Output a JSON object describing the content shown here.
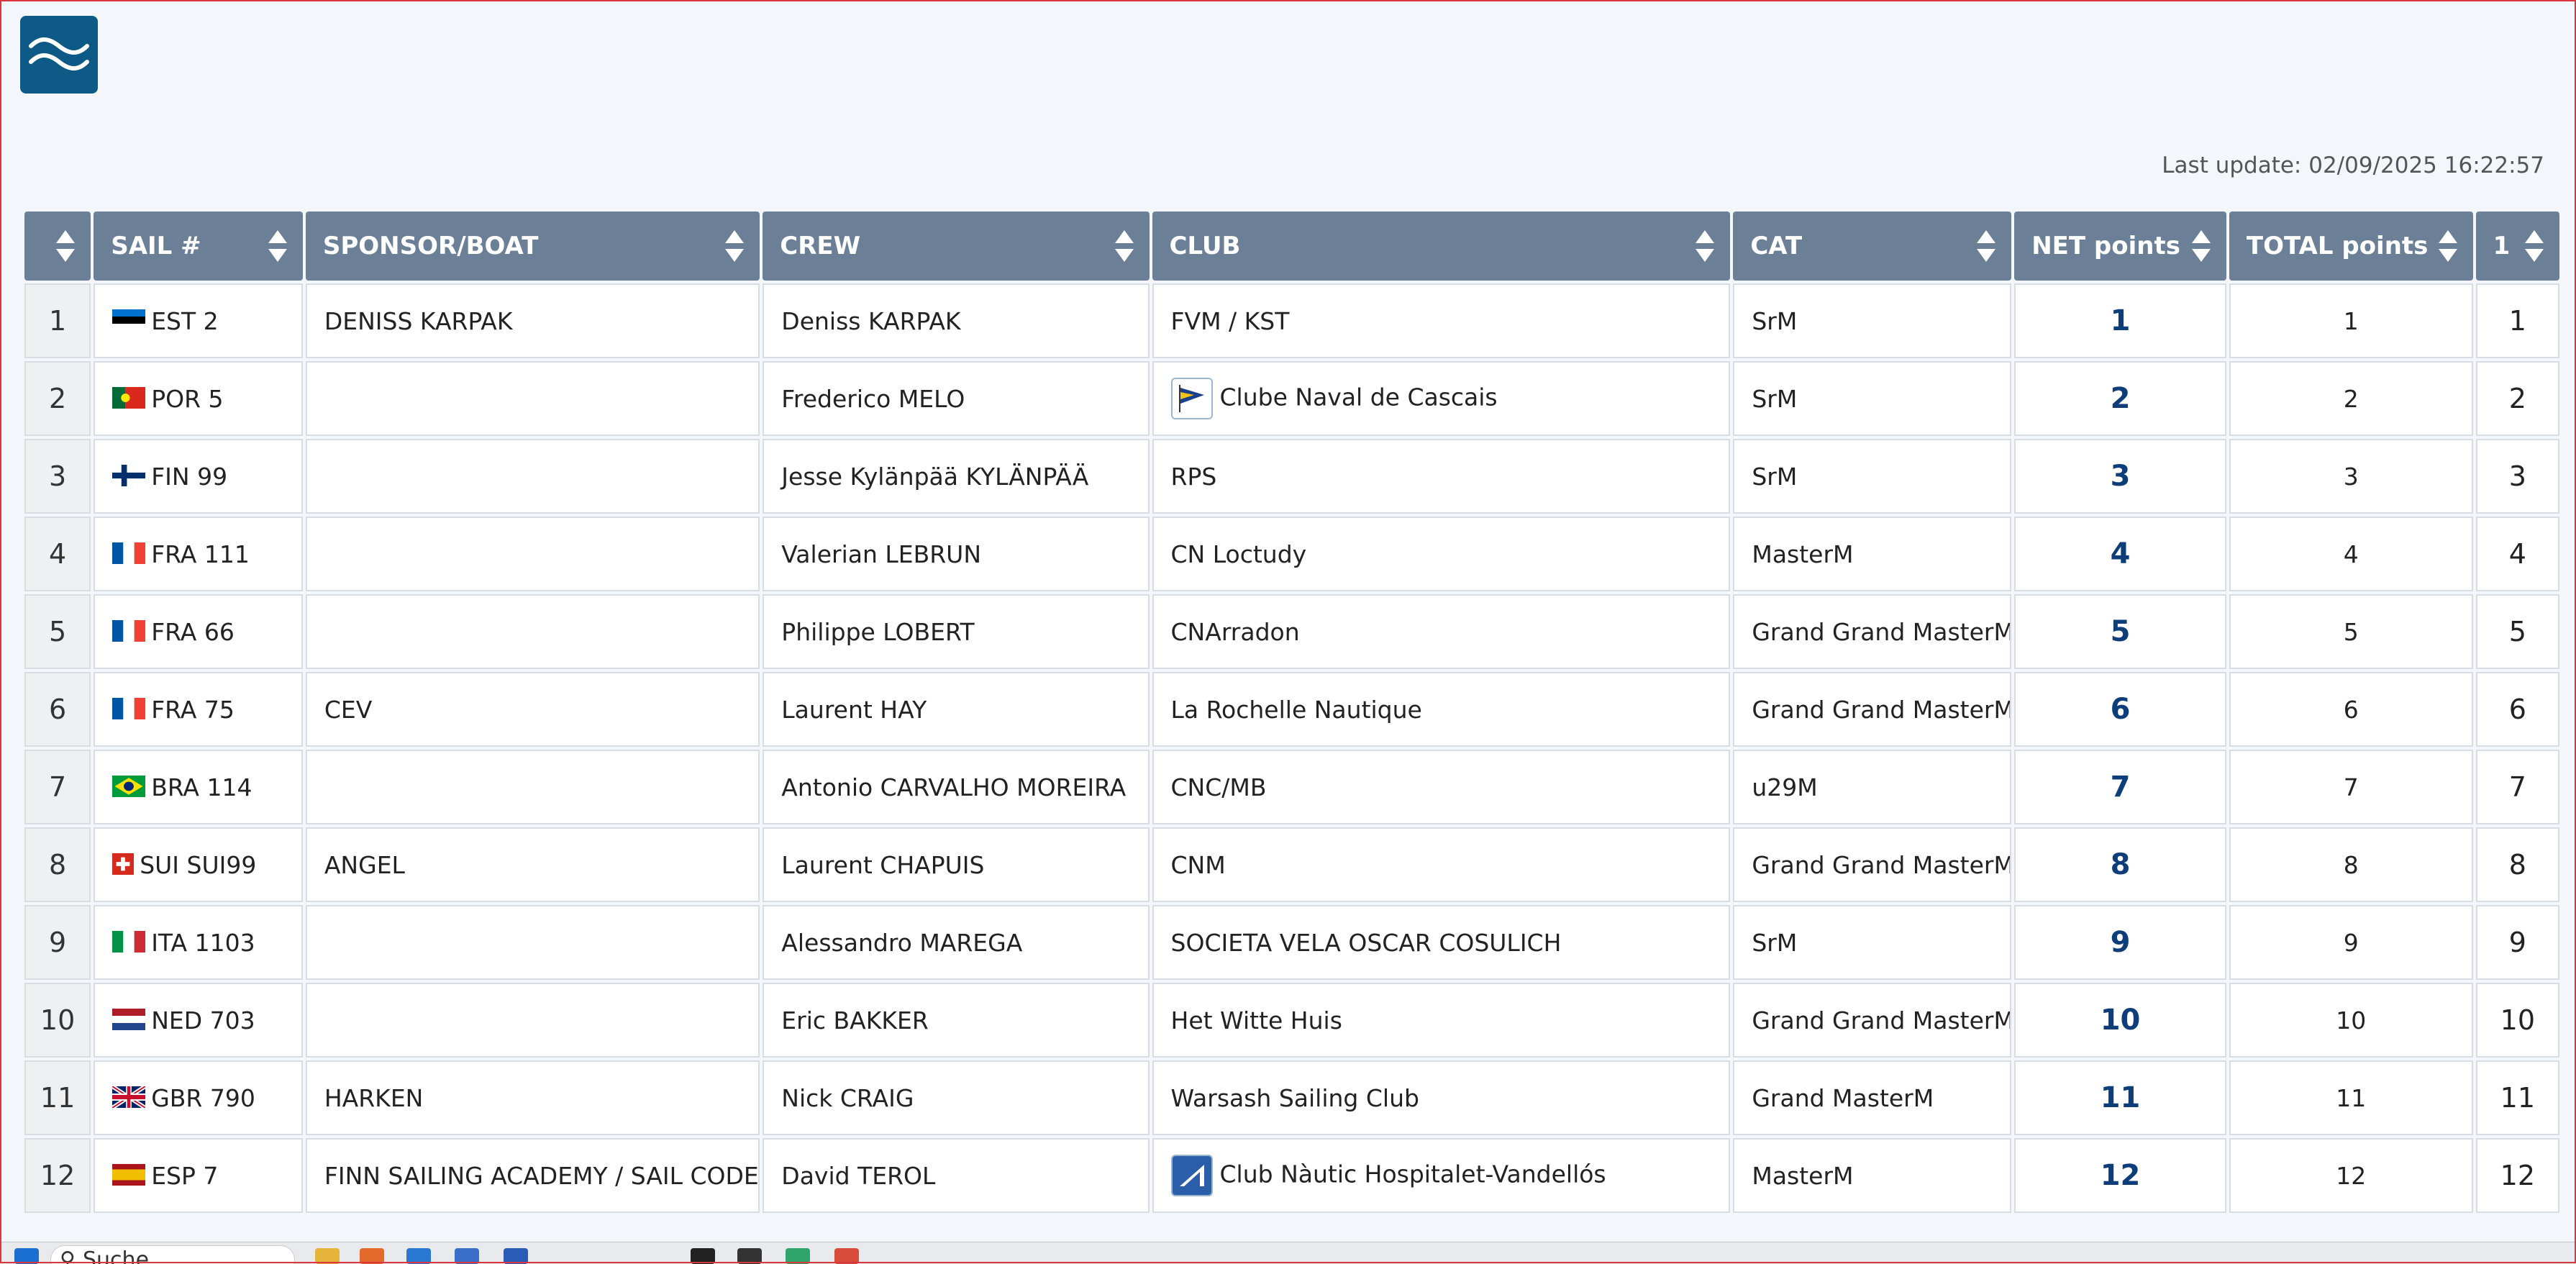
{
  "header": {
    "last_update": "Last update: 02/09/2025 16:22:57"
  },
  "table": {
    "columns": [
      "",
      "SAIL #",
      "SPONSOR/BOAT",
      "CREW",
      "CLUB",
      "CAT",
      "NET points",
      "TOTAL points",
      "1"
    ],
    "rows": [
      {
        "rank": "1",
        "flag": "EST",
        "sail": "EST 2",
        "sponsor": "DENISS KARPAK",
        "crew": "Deniss KARPAK",
        "club": "FVM / KST",
        "club_logo": false,
        "cat": "SrM",
        "net": "1",
        "total": "1",
        "r1": "1"
      },
      {
        "rank": "2",
        "flag": "POR",
        "sail": "POR 5",
        "sponsor": "",
        "crew": "Frederico MELO",
        "club": "Clube Naval de Cascais",
        "club_logo": "cncascais",
        "cat": "SrM",
        "net": "2",
        "total": "2",
        "r1": "2"
      },
      {
        "rank": "3",
        "flag": "FIN",
        "sail": "FIN 99",
        "sponsor": "",
        "crew": "Jesse Kylänpää KYLÄNPÄÄ",
        "club": "RPS",
        "club_logo": false,
        "cat": "SrM",
        "net": "3",
        "total": "3",
        "r1": "3"
      },
      {
        "rank": "4",
        "flag": "FRA",
        "sail": "FRA 111",
        "sponsor": "",
        "crew": "Valerian LEBRUN",
        "club": "CN Loctudy",
        "club_logo": false,
        "cat": "MasterM",
        "net": "4",
        "total": "4",
        "r1": "4"
      },
      {
        "rank": "5",
        "flag": "FRA",
        "sail": "FRA 66",
        "sponsor": "",
        "crew": "Philippe LOBERT",
        "club": "CNArradon",
        "club_logo": false,
        "cat": "Grand Grand MasterM",
        "net": "5",
        "total": "5",
        "r1": "5"
      },
      {
        "rank": "6",
        "flag": "FRA",
        "sail": "FRA 75",
        "sponsor": "CEV",
        "crew": "Laurent HAY",
        "club": "La Rochelle Nautique",
        "club_logo": false,
        "cat": "Grand Grand MasterM",
        "net": "6",
        "total": "6",
        "r1": "6"
      },
      {
        "rank": "7",
        "flag": "BRA",
        "sail": "BRA 114",
        "sponsor": "",
        "crew": "Antonio CARVALHO MOREIRA",
        "club": "CNC/MB",
        "club_logo": false,
        "cat": "u29M",
        "net": "7",
        "total": "7",
        "r1": "7"
      },
      {
        "rank": "8",
        "flag": "SUI",
        "sail": "SUI SUI99",
        "sponsor": "ANGEL",
        "crew": "Laurent CHAPUIS",
        "club": "CNM",
        "club_logo": false,
        "cat": "Grand Grand MasterM",
        "net": "8",
        "total": "8",
        "r1": "8"
      },
      {
        "rank": "9",
        "flag": "ITA",
        "sail": "ITA 1103",
        "sponsor": "",
        "crew": "Alessandro MAREGA",
        "club": "SOCIETA VELA OSCAR COSULICH",
        "club_logo": false,
        "cat": "SrM",
        "net": "9",
        "total": "9",
        "r1": "9"
      },
      {
        "rank": "10",
        "flag": "NED",
        "sail": "NED 703",
        "sponsor": "",
        "crew": "Eric BAKKER",
        "club": "Het Witte Huis",
        "club_logo": false,
        "cat": "Grand Grand MasterM",
        "net": "10",
        "total": "10",
        "r1": "10"
      },
      {
        "rank": "11",
        "flag": "GBR",
        "sail": "GBR 790",
        "sponsor": "HARKEN",
        "crew": "Nick CRAIG",
        "club": "Warsash Sailing Club",
        "club_logo": false,
        "cat": "Grand MasterM",
        "net": "11",
        "total": "11",
        "r1": "11"
      },
      {
        "rank": "12",
        "flag": "ESP",
        "sail": "ESP 7",
        "sponsor": "FINN SAILING ACADEMY / SAIL CODE",
        "crew": "David TEROL",
        "club": "Club Nàutic Hospitalet-Vandellós",
        "club_logo": "cnhv",
        "cat": "MasterM",
        "net": "12",
        "total": "12",
        "r1": "12"
      }
    ]
  },
  "taskbar": {
    "search_label": "Suche"
  },
  "colors": {
    "header_bg": "#6b7f96",
    "net_points": "#0e3e7a",
    "logo_bg": "#0d5a86"
  }
}
